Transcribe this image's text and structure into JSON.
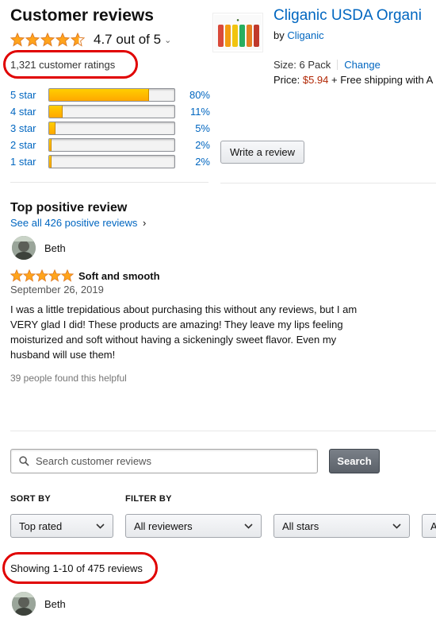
{
  "header": {
    "title": "Customer reviews",
    "rating_text": "4.7 out of 5",
    "ratings_count": "1,321 customer ratings",
    "average_rating": 4.7
  },
  "histogram": [
    {
      "label": "5 star",
      "pct": "80%",
      "fill": 0.8
    },
    {
      "label": "4 star",
      "pct": "11%",
      "fill": 0.11
    },
    {
      "label": "3 star",
      "pct": "5%",
      "fill": 0.05
    },
    {
      "label": "2 star",
      "pct": "2%",
      "fill": 0.02
    },
    {
      "label": "1 star",
      "pct": "2%",
      "fill": 0.02
    }
  ],
  "product": {
    "title": "Cliganic USDA Organi",
    "by_prefix": "by",
    "brand": "Cliganic",
    "size_label": "Size: 6 Pack",
    "change_label": "Change",
    "price_label": "Price:",
    "price": "$5.94",
    "shipping": "+ Free shipping with A"
  },
  "write_review_label": "Write a review",
  "top_review": {
    "section_title": "Top positive review",
    "see_all": "See all 426 positive reviews",
    "author": "Beth",
    "title": "Soft and smooth",
    "date": "September 26, 2019",
    "body": "I was a little trepidatious about purchasing this without any reviews, but I am VERY glad I did! These products are amazing! They leave my lips feeling moisturized and soft without having a sickeningly sweet flavor. Even my husband will use them!",
    "helpful": "39 people found this helpful",
    "stars": 5
  },
  "search": {
    "placeholder": "Search customer reviews",
    "button": "Search"
  },
  "filters": {
    "sort_by_label": "SORT BY",
    "filter_by_label": "FILTER BY",
    "sort_value": "Top rated",
    "reviewer_value": "All reviewers",
    "stars_value": "All stars",
    "partial_value": "A"
  },
  "showing": "Showing 1-10 of 475 reviews",
  "next_review_author": "Beth",
  "colors": {
    "link": "#0066c0",
    "star": "#ffa41c",
    "price": "#b12704",
    "highlight": "#e00000"
  }
}
